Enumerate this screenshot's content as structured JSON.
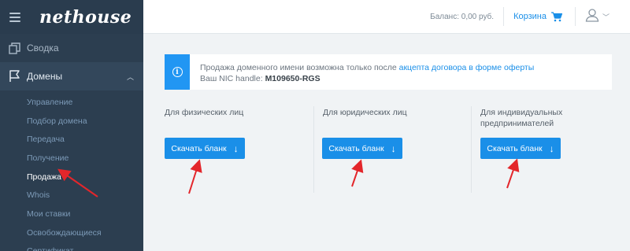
{
  "sidebar": {
    "logo": "nethouse",
    "main_items": [
      {
        "label": "Сводка"
      },
      {
        "label": "Домены"
      }
    ],
    "sub_items": [
      {
        "label": "Управление"
      },
      {
        "label": "Подбор домена"
      },
      {
        "label": "Передача"
      },
      {
        "label": "Получение"
      },
      {
        "label": "Продажа"
      },
      {
        "label": "Whois"
      },
      {
        "label": "Мои ставки"
      },
      {
        "label": "Освобождающиеся"
      },
      {
        "label": "Сертификат"
      }
    ]
  },
  "topbar": {
    "balance": "Баланс: 0,00 руб.",
    "cart_label": "Корзина"
  },
  "notice": {
    "text_before": "Продажа доменного имени возможна только после ",
    "link": "акцепта договора в форме оферты",
    "handle_label": "Ваш NIC handle: ",
    "handle_value": "M109650-RGS"
  },
  "columns": [
    {
      "label": "Для физических лиц",
      "button": "Скачать бланк"
    },
    {
      "label": "Для юридических лиц",
      "button": "Скачать бланк"
    },
    {
      "label": "Для индивидуальных предпринимателей",
      "button": "Скачать бланк"
    }
  ],
  "colors": {
    "sidebar_bg": "#2c3e50",
    "accent": "#1a8fe8",
    "annotation_arrow": "#e3262b"
  }
}
